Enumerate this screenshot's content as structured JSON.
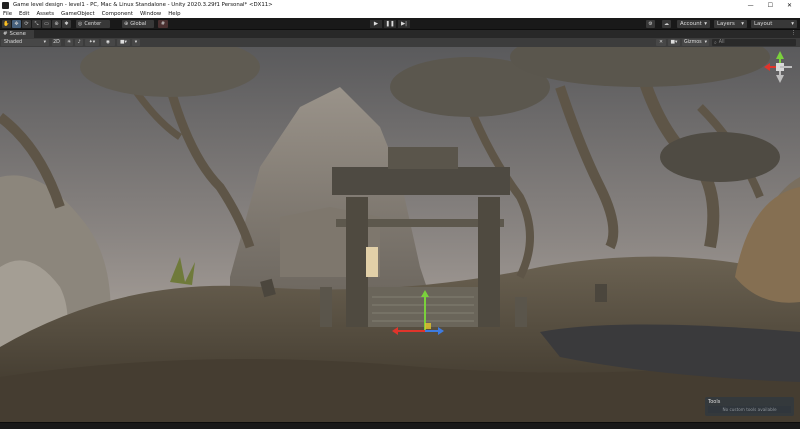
{
  "window": {
    "title": "Game level design - level1 - PC, Mac & Linux Standalone - Unity 2020.3.29f1 Personal* <DX11>",
    "buttons": [
      "—",
      "☐",
      "✕"
    ]
  },
  "menu": {
    "items": [
      "File",
      "Edit",
      "Assets",
      "GameObject",
      "Component",
      "Window",
      "Help"
    ]
  },
  "toolbar": {
    "pivot_label": "Center",
    "space_label": "Global",
    "play_icon": "▶",
    "pause_icon": "❚❚",
    "step_icon": "▶|",
    "account_label": "Account",
    "layers_label": "Layers",
    "layout_label": "Layout",
    "dropdown_arrow": "▾"
  },
  "scene_tab": {
    "label": "Scene",
    "menu_icon": "⋮"
  },
  "scene_toolbar": {
    "shading_mode": "Shaded",
    "mode_2d": "2D",
    "gizmos_label": "Gizmos",
    "search_placeholder": "All"
  },
  "tools_overlay": {
    "title": "Tools",
    "empty_text": "No custom tools available"
  },
  "colors": {
    "accent": "#46607c",
    "gizmo_x": "#e0342b",
    "gizmo_y": "#7ad03c",
    "gizmo_z": "#3e7be0"
  }
}
